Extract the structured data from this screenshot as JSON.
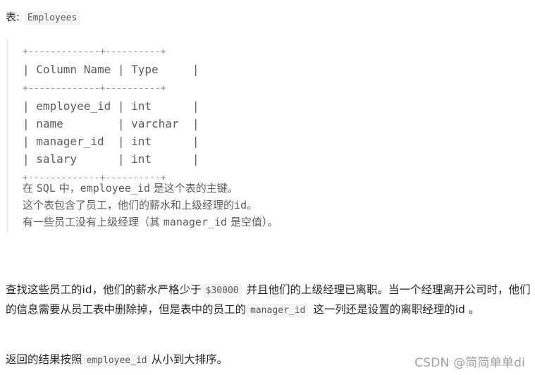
{
  "header": {
    "label": "表:",
    "table_name": "Employees"
  },
  "schema": {
    "border_top": "+-------------+----------+",
    "header_row": "| Column Name | Type     |",
    "border_mid": "+-------------+----------+",
    "rows": [
      "| employee_id | int      |",
      "| name        | varchar  |",
      "| manager_id  | int      |",
      "| salary      | int      |"
    ],
    "border_bottom": "+-------------+----------+",
    "columns": [
      "Column Name",
      "Type"
    ],
    "fields": [
      {
        "name": "employee_id",
        "type": "int"
      },
      {
        "name": "name",
        "type": "varchar"
      },
      {
        "name": "manager_id",
        "type": "int"
      },
      {
        "name": "salary",
        "type": "int"
      }
    ]
  },
  "notes": {
    "line1_a": "在 ",
    "line1_sql": "SQL",
    "line1_b": " 中，",
    "line1_code": "employee_id",
    "line1_c": " 是这个表的主键。",
    "line2_a": "这个表包含了员工，他们的薪水和上级经理的",
    "line2_code": "id",
    "line2_b": "。",
    "line3_a": "有一些员工没有上级经理（其 ",
    "line3_code": "manager_id",
    "line3_b": " 是空值）。"
  },
  "problem": {
    "p1_a": "查找这些员工的id，他们的薪水严格少于",
    "p1_code1": "$30000",
    "p1_b": " 并且他们的上级经理已离职。当一个经理离开公司时，他们的信息需要从员工表中删除掉，但是表中的员工的",
    "p1_code2": "manager_id",
    "p1_c": " 这一列还是设置的离职经理的id 。",
    "p2_a": "返回的结果按照",
    "p2_code": "employee_id",
    "p2_b": "从小到大排序。"
  },
  "watermark": "CSDN @简简单单di"
}
